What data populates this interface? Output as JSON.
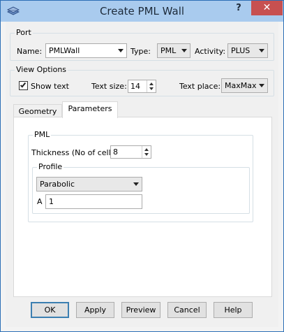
{
  "window": {
    "title": "Create PML Wall",
    "help_label": "?",
    "close_label": "✕",
    "app_icon": "layers-icon"
  },
  "port": {
    "legend": "Port",
    "name_label": "Name:",
    "name_value": "PMLWall",
    "type_label": "Type:",
    "type_value": "PML",
    "activity_label": "Activity:",
    "activity_value": "PLUS"
  },
  "view_options": {
    "legend": "View Options",
    "show_text_label": "Show text",
    "show_text_checked": true,
    "text_size_label": "Text size:",
    "text_size_value": "14",
    "text_place_label": "Text place:",
    "text_place_value": "MaxMax"
  },
  "tabs": [
    {
      "label": "Geometry",
      "active": false
    },
    {
      "label": "Parameters",
      "active": true
    }
  ],
  "pml": {
    "legend": "PML",
    "thickness_label": "Thickness (No of cells)",
    "thickness_value": "8",
    "profile": {
      "legend": "Profile",
      "selected": "Parabolic",
      "a_label": "A",
      "a_value": "1"
    }
  },
  "buttons": {
    "ok": "OK",
    "apply": "Apply",
    "preview": "Preview",
    "cancel": "Cancel",
    "help": "Help"
  }
}
